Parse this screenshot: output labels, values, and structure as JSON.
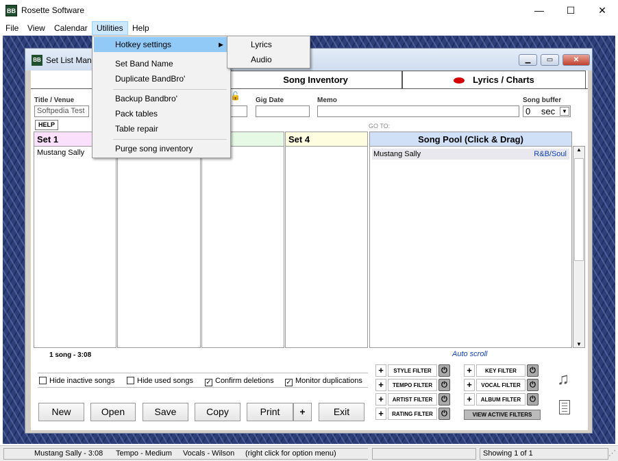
{
  "app": {
    "title": "Rosette Software",
    "icon": "BB"
  },
  "window_controls": {
    "minimize": "—",
    "maximize": "☐",
    "close": "✕"
  },
  "menubar": [
    "File",
    "View",
    "Calendar",
    "Utilities",
    "Help"
  ],
  "utilities_menu": {
    "items": [
      "Hotkey settings",
      "Set Band Name",
      "Duplicate BandBro'",
      "Backup Bandbro'",
      "Pack tables",
      "Table repair",
      "Purge song inventory"
    ],
    "submenu": [
      "Lyrics",
      "Audio"
    ]
  },
  "dialog": {
    "title": "Set List Mana",
    "tabs": {
      "song_inventory": "Song Inventory",
      "lyrics_charts": "Lyrics / Charts"
    },
    "title_venue": {
      "label": "Title / Venue",
      "value": "Softpedia Test"
    },
    "gig_date": {
      "label": "Gig Date",
      "value": ""
    },
    "memo": {
      "label": "Memo",
      "value": ""
    },
    "song_buffer": {
      "label": "Song buffer",
      "value": "0",
      "unit": "sec"
    },
    "help": "HELP",
    "goto": "GO TO:",
    "sets": [
      {
        "title": "Set 1",
        "color": "#fbe0fb",
        "items": [
          "Mustang Sally"
        ]
      },
      {
        "title": "",
        "color": "#ffffff",
        "items": []
      },
      {
        "title": "",
        "color": "#e5f9e5",
        "items": []
      },
      {
        "title": "Set 4",
        "color": "#fffde0",
        "items": []
      }
    ],
    "pool": {
      "title": "Song Pool (Click & Drag)",
      "rows": [
        {
          "title": "Mustang Sally",
          "genre": "R&B/Soul"
        }
      ]
    },
    "song_count": "1 song  -   3:08",
    "auto_scroll": "Auto scroll",
    "checkboxes": [
      {
        "label": "Hide inactive songs",
        "checked": false
      },
      {
        "label": "Hide used songs",
        "checked": false
      },
      {
        "label": "Confirm deletions",
        "checked": true
      },
      {
        "label": "Monitor duplications",
        "checked": true
      }
    ],
    "buttons": [
      "New",
      "Open",
      "Save",
      "Copy",
      "Print",
      "+",
      "Exit"
    ],
    "filters_left": [
      "STYLE FILTER",
      "TEMPO FILTER",
      "ARTIST FILTER",
      "RATING FILTER"
    ],
    "filters_right": [
      "KEY FILTER",
      "VOCAL FILTER",
      "ALBUM FILTER"
    ],
    "view_active_filters": "VIEW ACTIVE FILTERS",
    "icons": [
      "music-note-icon",
      "document-icon",
      "lock-icon"
    ]
  },
  "statusbar": {
    "song": "Mustang Sally - 3:08",
    "tempo": "Tempo - Medium",
    "vocals": "Vocals - Wilson",
    "hint": "(right click for option menu)",
    "showing": "Showing 1 of 1"
  }
}
